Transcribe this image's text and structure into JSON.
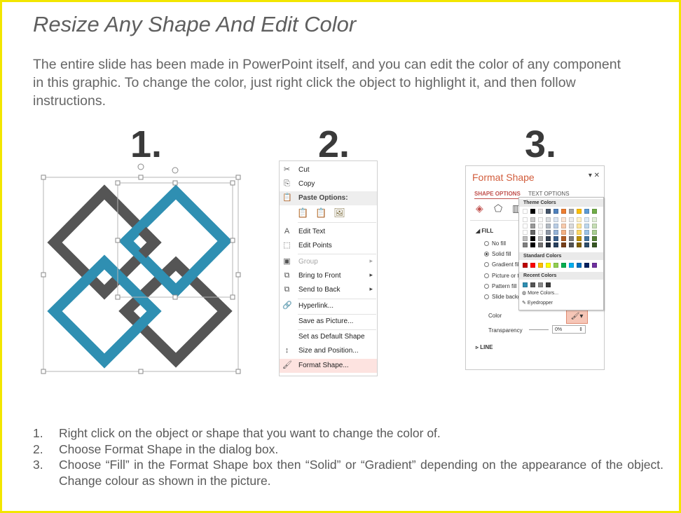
{
  "title": "Resize Any Shape And Edit Color",
  "intro": "The entire slide has been made in PowerPoint itself, and you can edit the color of any component in this graphic. To change the color, just right click the object to highlight it, and then follow instructions.",
  "step_numbers": [
    "1.",
    "2.",
    "3."
  ],
  "colors": {
    "border": "#f2e600",
    "teal": "#2f8fb2",
    "gray": "#555555",
    "accent": "#d25d3c"
  },
  "context_menu": {
    "items": [
      {
        "label": "Cut",
        "icon": "scissors-icon",
        "glyph": "✂"
      },
      {
        "label": "Copy",
        "icon": "copy-icon",
        "glyph": "⎘"
      },
      {
        "label": "Paste Options:",
        "icon": "paste-icon",
        "glyph": "📋"
      },
      {
        "label": "Edit Text",
        "icon": "edit-text-icon",
        "glyph": "A"
      },
      {
        "label": "Edit Points",
        "icon": "edit-points-icon",
        "glyph": "⬚"
      },
      {
        "label": "Group",
        "icon": "group-icon",
        "glyph": "▣"
      },
      {
        "label": "Bring to Front",
        "icon": "bring-front-icon",
        "glyph": "⧉"
      },
      {
        "label": "Send to Back",
        "icon": "send-back-icon",
        "glyph": "⧉"
      },
      {
        "label": "Hyperlink...",
        "icon": "hyperlink-icon",
        "glyph": "🔗"
      },
      {
        "label": "Save as Picture...",
        "icon": "",
        "glyph": ""
      },
      {
        "label": "Set as Default Shape",
        "icon": "",
        "glyph": ""
      },
      {
        "label": "Size and Position...",
        "icon": "size-icon",
        "glyph": "↕"
      },
      {
        "label": "Format Shape...",
        "icon": "format-shape-icon",
        "glyph": "🖌"
      }
    ],
    "paste_icons": [
      "paste-keep-icon",
      "paste-merge-icon",
      "paste-picture-icon"
    ]
  },
  "format_panel": {
    "title": "Format Shape",
    "tab_shape": "SHAPE OPTIONS",
    "tab_text": "TEXT OPTIONS",
    "fill_header": "FILL",
    "options": [
      "No fill",
      "Solid fill",
      "Gradient fill",
      "Picture or t",
      "Pattern fill",
      "Slide backg"
    ],
    "selected_option": "Solid fill",
    "color_label": "Color",
    "transparency_label": "Transparency",
    "transparency_value": "0%",
    "line_header": "LINE",
    "popup": {
      "theme_header": "Theme Colors",
      "standard_header": "Standard Colors",
      "recent_header": "Recent Colors",
      "more_colors": "More Colors...",
      "eyedropper": "Eyedropper",
      "theme_top": [
        "#ffffff",
        "#000000",
        "#e7e6e6",
        "#44546a",
        "#4f81bd",
        "#ed7d31",
        "#a5a5a5",
        "#ffc000",
        "#5b9bd5",
        "#70ad47"
      ],
      "standard": [
        "#c00000",
        "#ff0000",
        "#ffc000",
        "#ffff00",
        "#92d050",
        "#00b050",
        "#00b0f0",
        "#0070c0",
        "#002060",
        "#7030a0"
      ],
      "recent": [
        "#2f8fb2",
        "#555555",
        "#8a8a8a",
        "#3a3a3a"
      ]
    }
  },
  "steps": [
    {
      "num": "1.",
      "text": "Right click on the object or shape that you want to change the color of."
    },
    {
      "num": "2.",
      "text": "Choose Format Shape in the dialog box."
    },
    {
      "num": "3.",
      "text": "Choose “Fill” in the Format Shape box then “Solid” or “Gradient” depending on the appearance of the object. Change colour as shown in the picture."
    }
  ]
}
